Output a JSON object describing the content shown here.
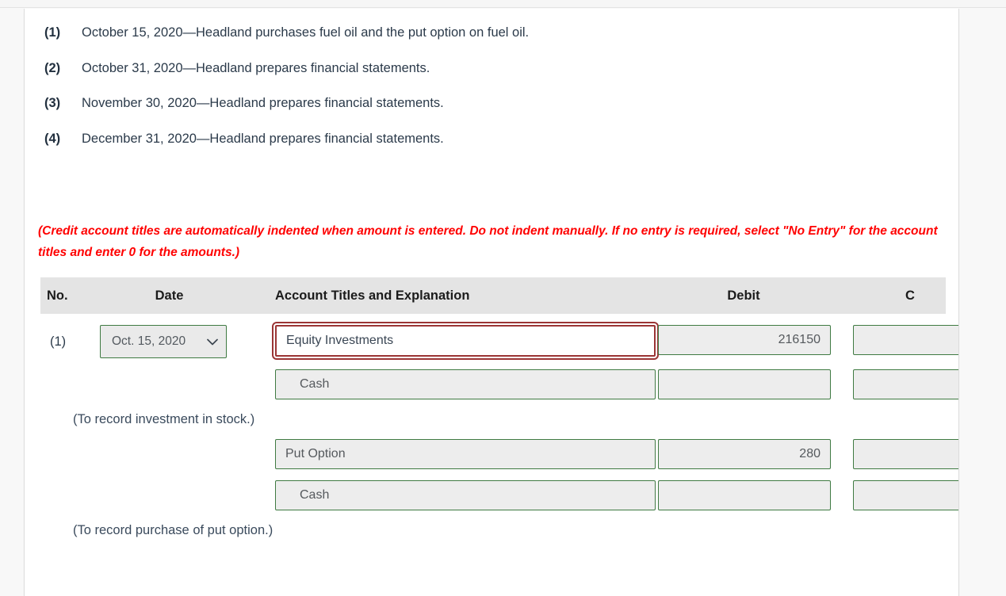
{
  "instructions": {
    "items": [
      {
        "tag": "(1)",
        "text": "October 15, 2020—Headland purchases fuel oil and the put option on fuel oil."
      },
      {
        "tag": "(2)",
        "text": "October 31, 2020—Headland prepares financial statements."
      },
      {
        "tag": "(3)",
        "text": "November 30, 2020—Headland prepares financial statements."
      },
      {
        "tag": "(4)",
        "text": "December 31, 2020—Headland prepares financial statements."
      }
    ]
  },
  "note": {
    "text": "(Credit account titles are automatically indented when amount is entered. Do not indent manually. If no entry is required, select \"No Entry\" for the account titles and enter 0 for the amounts.)",
    "color": "#ff0000"
  },
  "journal": {
    "headers": {
      "no": "No.",
      "date": "Date",
      "account": "Account Titles and Explanation",
      "debit": "Debit",
      "credit": "C"
    },
    "header_bg": "#e4e4e4",
    "field_border_color": "#3f7a42",
    "highlight_border_color": "#9b3535",
    "rows": [
      {
        "no": "(1)",
        "date_value": "Oct. 15, 2020",
        "account": "Equity Investments",
        "account_indented": false,
        "highlighted": true,
        "debit": "216150",
        "credit": ""
      },
      {
        "no": "",
        "date_value": "",
        "account": "Cash",
        "account_indented": true,
        "highlighted": false,
        "debit": "",
        "credit": ""
      }
    ],
    "memo_1": "(To record investment in stock.)",
    "rows_2": [
      {
        "no": "",
        "date_value": "",
        "account": "Put Option",
        "account_indented": false,
        "highlighted": false,
        "debit": "280",
        "credit": ""
      },
      {
        "no": "",
        "date_value": "",
        "account": "Cash",
        "account_indented": true,
        "highlighted": false,
        "debit": "",
        "credit": ""
      }
    ],
    "memo_2": "(To record purchase of put option.)"
  }
}
